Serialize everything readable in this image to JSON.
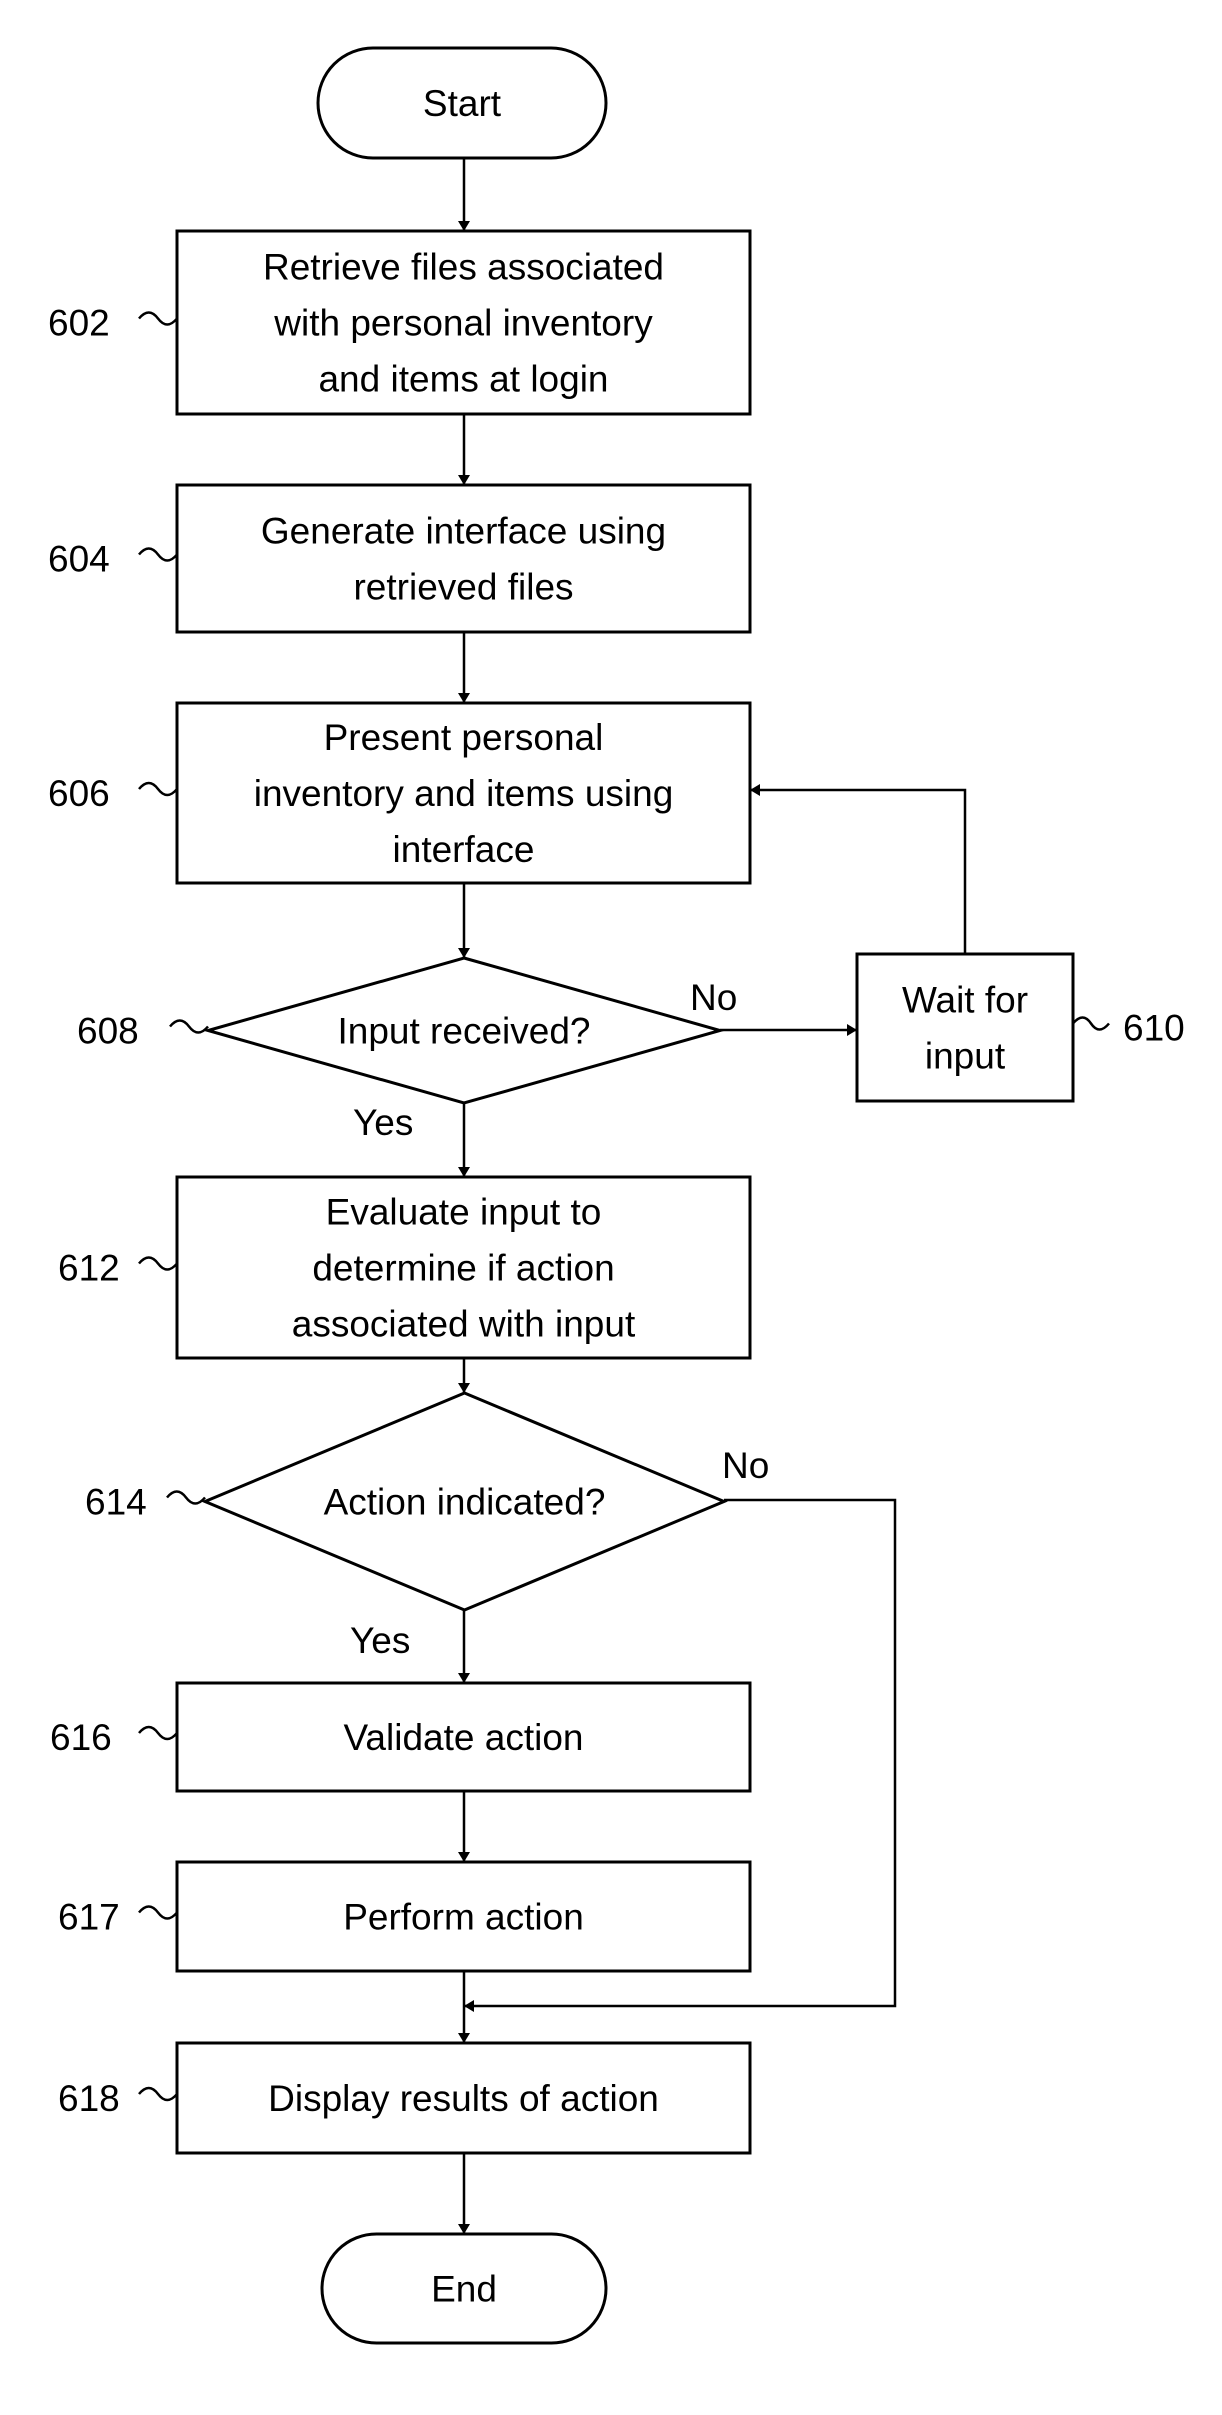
{
  "diagram": {
    "type": "flowchart",
    "nodes": [
      {
        "id": "start",
        "shape": "terminal",
        "lines": [
          "Start"
        ]
      },
      {
        "id": "602",
        "shape": "process",
        "ref": "602",
        "lines": [
          "Retrieve files associated",
          "with personal inventory",
          "and items at login"
        ]
      },
      {
        "id": "604",
        "shape": "process",
        "ref": "604",
        "lines": [
          "Generate interface using",
          "retrieved files"
        ]
      },
      {
        "id": "606",
        "shape": "process",
        "ref": "606",
        "lines": [
          "Present personal",
          "inventory and items using",
          "interface"
        ]
      },
      {
        "id": "608",
        "shape": "decision",
        "ref": "608",
        "lines": [
          "Input received?"
        ]
      },
      {
        "id": "610",
        "shape": "process",
        "ref": "610",
        "lines": [
          "Wait for",
          "input"
        ]
      },
      {
        "id": "612",
        "shape": "process",
        "ref": "612",
        "lines": [
          "Evaluate input to",
          "determine if action",
          "associated with input"
        ]
      },
      {
        "id": "614",
        "shape": "decision",
        "ref": "614",
        "lines": [
          "Action indicated?"
        ]
      },
      {
        "id": "616",
        "shape": "process",
        "ref": "616",
        "lines": [
          "Validate action"
        ]
      },
      {
        "id": "617",
        "shape": "process",
        "ref": "617",
        "lines": [
          "Perform action"
        ]
      },
      {
        "id": "618",
        "shape": "process",
        "ref": "618",
        "lines": [
          "Display results of action"
        ]
      },
      {
        "id": "end",
        "shape": "terminal",
        "lines": [
          "End"
        ]
      }
    ],
    "edges": [
      {
        "from": "start",
        "to": "602",
        "label": ""
      },
      {
        "from": "602",
        "to": "604",
        "label": ""
      },
      {
        "from": "604",
        "to": "606",
        "label": ""
      },
      {
        "from": "606",
        "to": "608",
        "label": ""
      },
      {
        "from": "608",
        "to": "610",
        "label": "No"
      },
      {
        "from": "610",
        "to": "606",
        "label": ""
      },
      {
        "from": "608",
        "to": "612",
        "label": "Yes"
      },
      {
        "from": "612",
        "to": "614",
        "label": ""
      },
      {
        "from": "614",
        "to": "616",
        "label": "Yes"
      },
      {
        "from": "614",
        "to": "618",
        "label": "No"
      },
      {
        "from": "616",
        "to": "617",
        "label": ""
      },
      {
        "from": "617",
        "to": "618",
        "label": ""
      },
      {
        "from": "618",
        "to": "end",
        "label": ""
      }
    ]
  }
}
